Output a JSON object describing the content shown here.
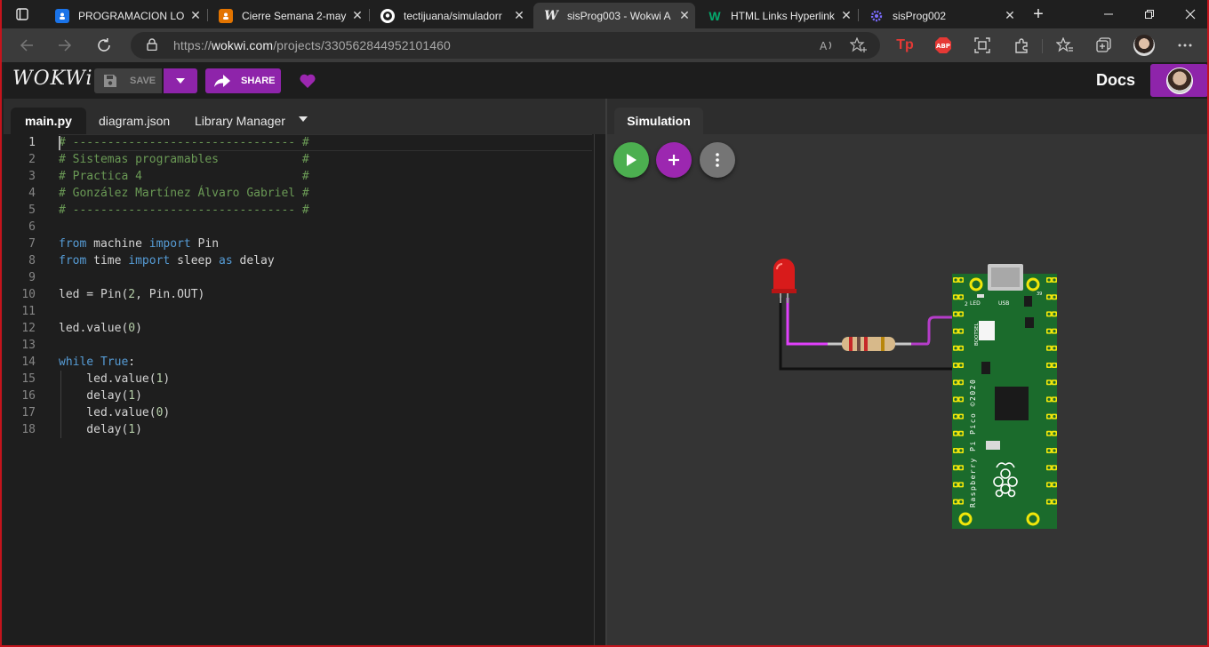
{
  "browser": {
    "tabs": [
      {
        "title": "PROGRAMACION LOG",
        "favicon": "classroom-icon",
        "active": false
      },
      {
        "title": "Cierre Semana 2-may",
        "favicon": "classroom-orange-icon",
        "active": false
      },
      {
        "title": "tectijuana/simuladorr",
        "favicon": "github-icon",
        "active": false
      },
      {
        "title": "sisProg003 - Wokwi A",
        "favicon": "wokwi-icon",
        "active": true
      },
      {
        "title": "HTML Links Hyperlink",
        "favicon": "w3schools-icon",
        "active": false
      },
      {
        "title": "sisProg002",
        "favicon": "wokwi-gear-icon",
        "active": false
      }
    ],
    "new_tab": "+",
    "url_prefix": "https://",
    "url_host": "wokwi.com",
    "url_path": "/projects/330562844952101460",
    "extensions": {
      "tp": "Tp",
      "abp": "ABP"
    }
  },
  "app": {
    "logo": "WOKWi",
    "save_label": "SAVE",
    "share_label": "SHARE",
    "docs_label": "Docs"
  },
  "editor": {
    "tabs": [
      "main.py",
      "diagram.json",
      "Library Manager"
    ],
    "active_tab": "main.py",
    "line_numbers": [
      "1",
      "2",
      "3",
      "4",
      "5",
      "6",
      "7",
      "8",
      "9",
      "10",
      "11",
      "12",
      "13",
      "14",
      "15",
      "16",
      "17",
      "18"
    ]
  },
  "simulation": {
    "tab_label": "Simulation",
    "board": "Raspberry Pi Pico ©2020",
    "board_labels": {
      "led": "LED",
      "usb": "USB",
      "bootsel": "BOOTSEL",
      "pin1": "2",
      "pin39": "39"
    }
  },
  "colors": {
    "accent": "#8e24aa",
    "run": "#4caf50",
    "board": "#1b6b2c",
    "wire_signal": "#e040fb",
    "led": "#e01e1e"
  }
}
